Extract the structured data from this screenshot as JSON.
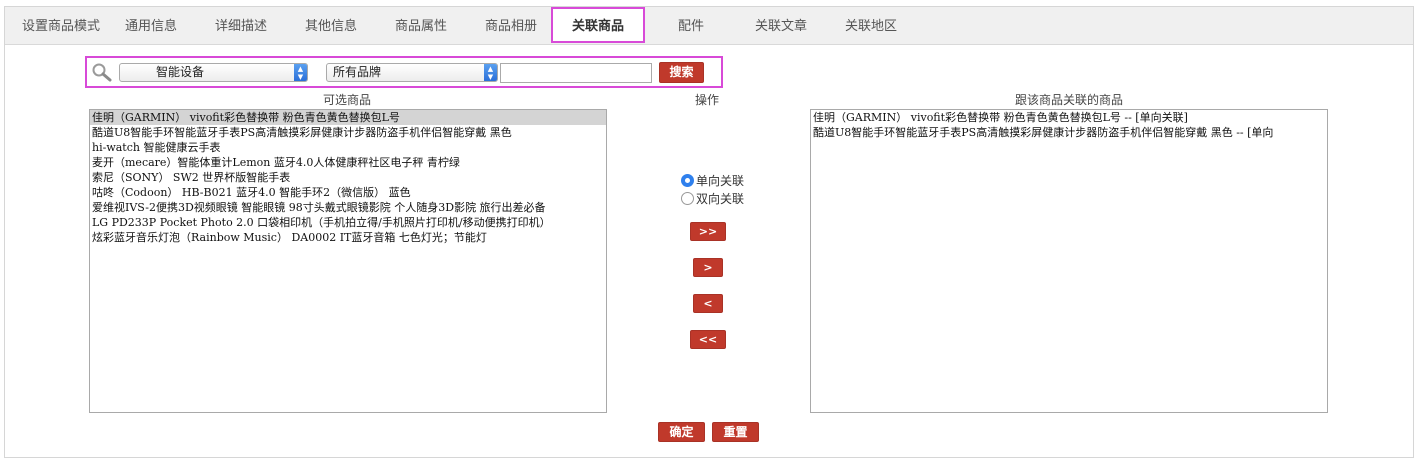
{
  "tabs": [
    {
      "label": "设置商品模式",
      "active": false
    },
    {
      "label": "通用信息",
      "active": false
    },
    {
      "label": "详细描述",
      "active": false
    },
    {
      "label": "其他信息",
      "active": false
    },
    {
      "label": "商品属性",
      "active": false
    },
    {
      "label": "商品相册",
      "active": false
    },
    {
      "label": "关联商品",
      "active": true
    },
    {
      "label": "配件",
      "active": false
    },
    {
      "label": "关联文章",
      "active": false
    },
    {
      "label": "关联地区",
      "active": false
    }
  ],
  "search": {
    "icon": "search-icon",
    "category_selected": "智能设备",
    "brand_selected": "所有品牌",
    "keyword_value": "",
    "button_label": "搜索"
  },
  "available": {
    "title": "可选商品",
    "items": [
      "佳明（GARMIN） vivofit彩色替换带 粉色青色黄色替换包L号",
      "酷道U8智能手环智能蓝牙手表PS高清触摸彩屏健康计步器防盗手机伴侣智能穿戴 黑色",
      "hi-watch 智能健康云手表",
      "麦开（mecare）智能体重计Lemon 蓝牙4.0人体健康秤社区电子秤 青柠绿",
      "索尼（SONY） SW2 世界杯版智能手表",
      "咕咚（Codoon） HB-B021 蓝牙4.0 智能手环2（微信版） 蓝色",
      "爱维视IVS-2便携3D视频眼镜 智能眼镜 98寸头戴式眼镜影院 个人随身3D影院 旅行出差必备",
      "LG PD233P Pocket Photo 2.0 口袋相印机（手机拍立得/手机照片打印机/移动便携打印机）",
      "炫彩蓝牙音乐灯泡（Rainbow Music） DA0002 IT蓝牙音箱 七色灯光；节能灯"
    ],
    "selected_index": 0
  },
  "operation": {
    "title": "操作",
    "radio_one_way": "单向关联",
    "radio_two_way": "双向关联",
    "selected": "one_way",
    "btn_add_all": ">>",
    "btn_add": ">",
    "btn_remove": "<",
    "btn_remove_all": "<<"
  },
  "linked": {
    "title": "跟该商品关联的商品",
    "items": [
      "佳明（GARMIN） vivofit彩色替换带 粉色青色黄色替换包L号 -- [单向关联]",
      "酷道U8智能手环智能蓝牙手表PS高清触摸彩屏健康计步器防盗手机伴侣智能穿戴 黑色 -- [单向"
    ]
  },
  "footer": {
    "confirm_label": "确定",
    "reset_label": "重置"
  },
  "colors": {
    "accent_red": "#c0392b",
    "highlight_magenta": "#d84ad8",
    "radio_blue": "#2f80ed"
  }
}
